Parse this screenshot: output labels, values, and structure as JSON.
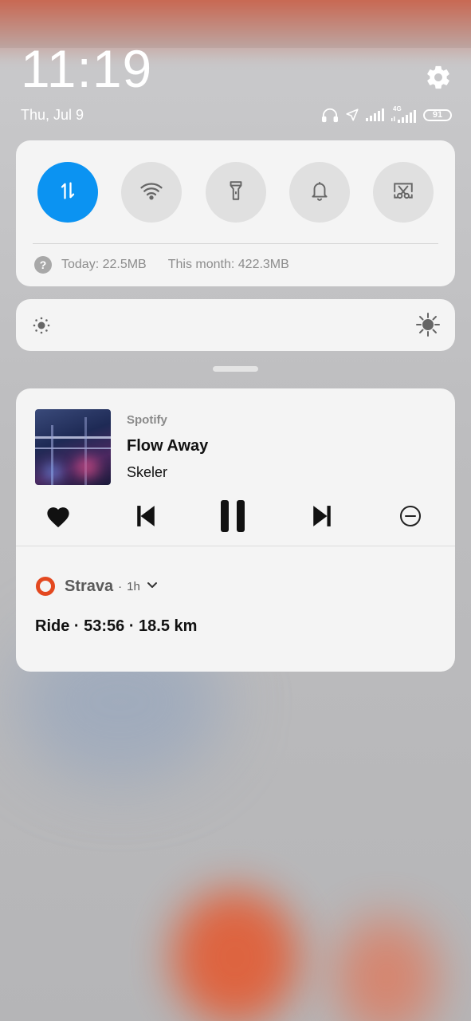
{
  "status_bar": {
    "clock": "11:19",
    "date": "Thu, Jul 9",
    "network": "4G",
    "battery": "91"
  },
  "quick_settings": {
    "tiles": [
      {
        "icon": "data-transfer-icon",
        "active": true
      },
      {
        "icon": "wifi-icon",
        "active": false
      },
      {
        "icon": "flashlight-icon",
        "active": false
      },
      {
        "icon": "bell-icon",
        "active": false
      },
      {
        "icon": "screenshot-icon",
        "active": false
      }
    ],
    "usage_today": "Today: 22.5MB",
    "usage_month": "This month: 422.3MB"
  },
  "brightness": {
    "low_icon": "brightness-low-icon",
    "high_icon": "brightness-high-icon"
  },
  "media_notification": {
    "app": "Spotify",
    "title": "Flow Away",
    "artist": "Skeler",
    "controls": [
      "heart-icon",
      "previous-icon",
      "pause-icon",
      "next-icon",
      "remove-icon"
    ]
  },
  "strava_notification": {
    "app": "Strava",
    "separator": "·",
    "time": "1h",
    "content": "Ride · 53:56 · 18.5 km",
    "accent": "#e3481f"
  },
  "colors": {
    "active_tile": "#0b93f2",
    "card_bg": "#f4f4f4"
  }
}
